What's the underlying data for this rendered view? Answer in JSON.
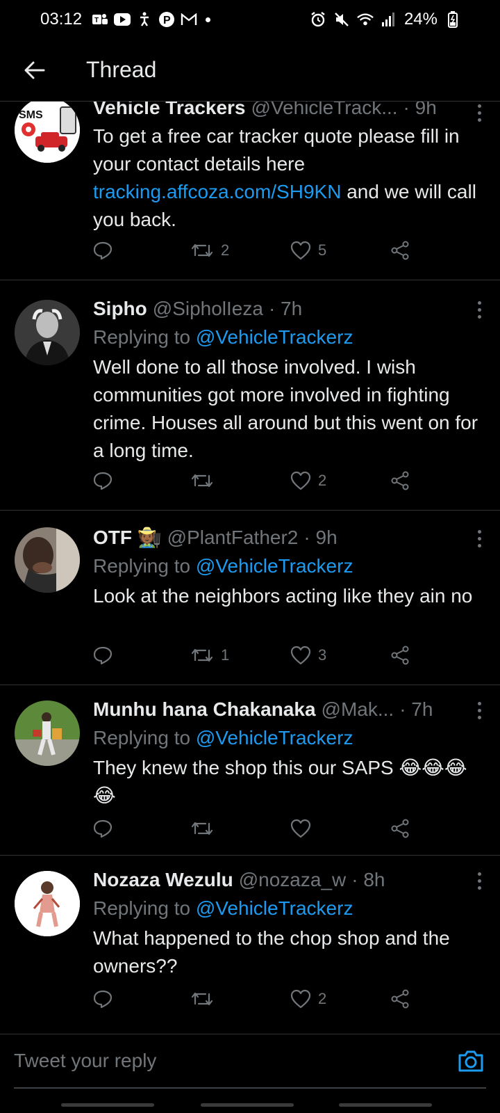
{
  "status_bar": {
    "time": "03:12",
    "battery": "24%"
  },
  "header": {
    "title": "Thread",
    "back_icon": "arrow-left-icon"
  },
  "tweets": [
    {
      "name": "Vehicle Trackers",
      "handle": "@VehicleTrack...",
      "time": "· 9h",
      "replying_prefix": "",
      "replying_to": "",
      "text_before": "To get a free car tracker quote please fill in your contact details here ",
      "link": "tracking.affcoza.com/SH9KN",
      "text_after": " and we will call you back.",
      "retweets": "2",
      "likes": "5",
      "avatar_text": "SMS"
    },
    {
      "name": "Sipho",
      "handle": "@SipholIeza",
      "time": "· 7h",
      "replying_prefix": "Replying to ",
      "replying_to": "@VehicleTrackerz",
      "text": "Well done to all those involved. I wish communities got more involved in fighting crime. Houses all around but this went on for a long time.",
      "retweets": "",
      "likes": "2"
    },
    {
      "name": "OTF 🧑🏾‍🌾",
      "handle": "@PlantFather2",
      "time": "· 9h",
      "replying_prefix": "Replying to ",
      "replying_to": "@VehicleTrackerz",
      "text": "Look at the neighbors acting like they ain no",
      "retweets": "1",
      "likes": "3"
    },
    {
      "name": "Munhu hana Chakanaka",
      "handle": "@Mak...",
      "time": "· 7h",
      "replying_prefix": "Replying to ",
      "replying_to": "@VehicleTrackerz",
      "text": "They knew the shop this our SAPS 😂😂😂😂",
      "retweets": "",
      "likes": ""
    },
    {
      "name": "Nozaza Wezulu",
      "handle": "@nozaza_w",
      "time": "· 8h",
      "replying_prefix": "Replying to ",
      "replying_to": "@VehicleTrackerz",
      "text": "What happened to the chop shop and the owners??",
      "retweets": "",
      "likes": "2"
    }
  ],
  "reply_bar": {
    "placeholder": "Tweet your reply",
    "camera_icon": "camera-icon"
  },
  "colors": {
    "background": "#000000",
    "link": "#1d9bf0",
    "secondary_text": "#71767b",
    "divider": "#2f3336"
  }
}
